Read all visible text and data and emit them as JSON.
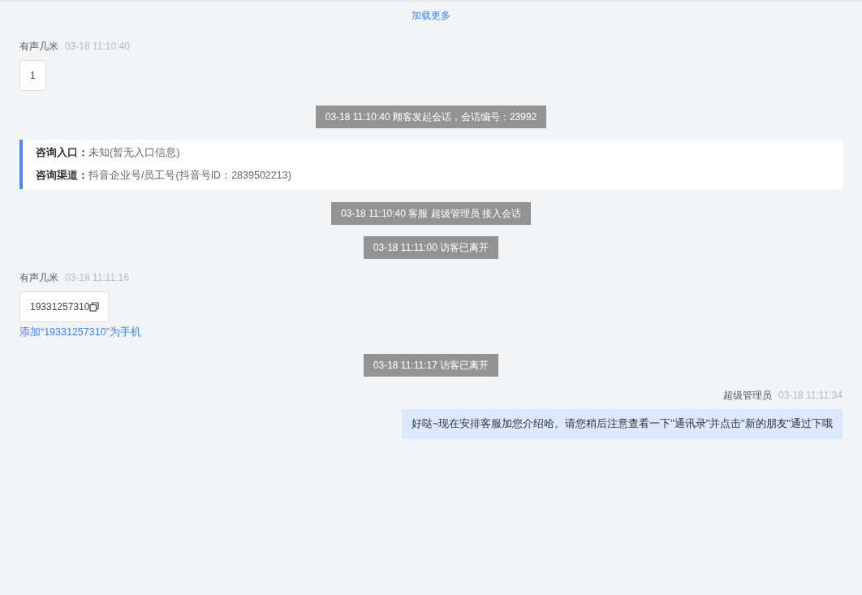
{
  "load_more": "加载更多",
  "items": [
    {
      "kind": "incoming",
      "sender": "有声几米",
      "time": "03-18 11:10:40",
      "text": "1",
      "copyable": false
    },
    {
      "kind": "system",
      "text": "03-18 11:10:40 顾客发起会话，会话编号：23992"
    },
    {
      "kind": "info",
      "rows": [
        {
          "label": "咨询入口：",
          "value": "未知(暂无入口信息)"
        },
        {
          "label": "咨询渠道：",
          "value": "抖音企业号/员工号(抖音号ID：2839502213)"
        }
      ]
    },
    {
      "kind": "system",
      "text": "03-18 11:10:40 客服 超级管理员 接入会话"
    },
    {
      "kind": "system",
      "text": "03-18 11:11:00 访客已离开"
    },
    {
      "kind": "incoming",
      "sender": "有声几米",
      "time": "03-18 11:11:16",
      "text": "19331257310",
      "copyable": true,
      "action_link": "添加“19331257310”为手机"
    },
    {
      "kind": "system",
      "text": "03-18 11:11:17 访客已离开"
    },
    {
      "kind": "outgoing",
      "sender": "超级管理员",
      "time": "03-18 11:11:34",
      "text": "好哒~现在安排客服加您介绍哈。请您稍后注意查看一下\"通讯录\"并点击\"新的朋友\"通过下哦",
      "copyable": false
    }
  ]
}
